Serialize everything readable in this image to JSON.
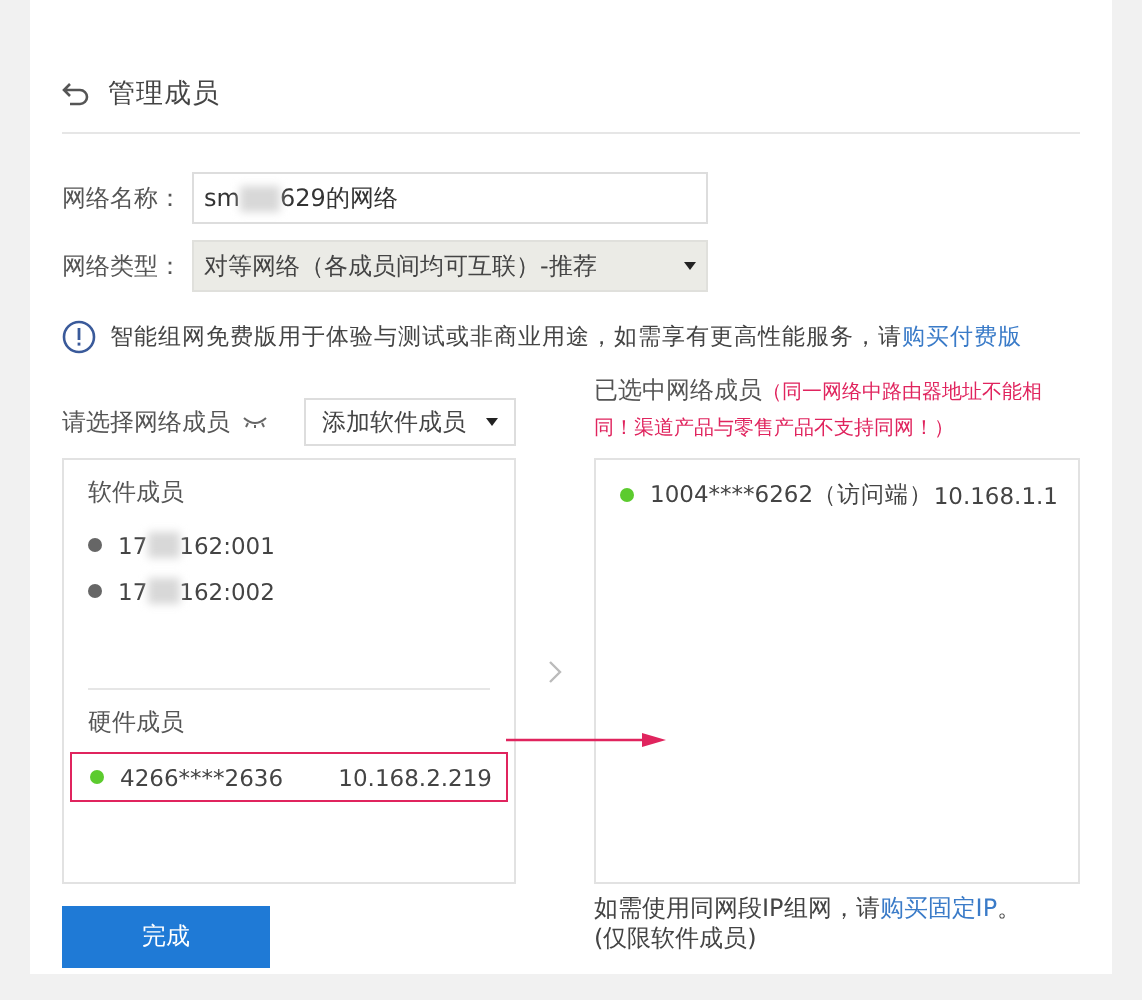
{
  "header": {
    "title": "管理成员"
  },
  "fields": [
    {
      "kind": "input",
      "label": "网络名称：",
      "value_parts": [
        "sm",
        "629的网络"
      ]
    },
    {
      "kind": "select",
      "label": "网络类型：",
      "value": "对等网络（各成员间均可互联）-推荐"
    }
  ],
  "notice": {
    "text": "智能组网免费版用于体验与测试或非商业用途，如需享有更高性能服务，请",
    "link": "购买付费版"
  },
  "left": {
    "label": "请选择网络成员",
    "add_button": "添加软件成员",
    "groups": [
      {
        "title": "软件成员",
        "members": [
          {
            "name_parts": [
              "17",
              "162:001"
            ],
            "online": false,
            "highlighted": false
          },
          {
            "name_parts": [
              "17",
              "162:002"
            ],
            "online": false,
            "highlighted": false
          }
        ]
      },
      {
        "title": "硬件成员",
        "members": [
          {
            "name_parts": [
              "4266****2636"
            ],
            "ip": "10.168.2.219",
            "online": true,
            "highlighted": true
          }
        ]
      }
    ]
  },
  "right": {
    "label": "已选中网络成员",
    "warning": "（同一网络中路由器地址不能相同！渠道产品与零售产品不支持同网！）",
    "members": [
      {
        "name_parts": [
          "1004****6262（访问端）"
        ],
        "ip": "10.168.1.1",
        "online": true,
        "highlighted": false
      }
    ],
    "note": {
      "text": "如需使用同网段IP组网，请",
      "link": "购买固定IP",
      "end": "。",
      "line2": "(仅限软件成员)"
    }
  },
  "done_button": "完成"
}
